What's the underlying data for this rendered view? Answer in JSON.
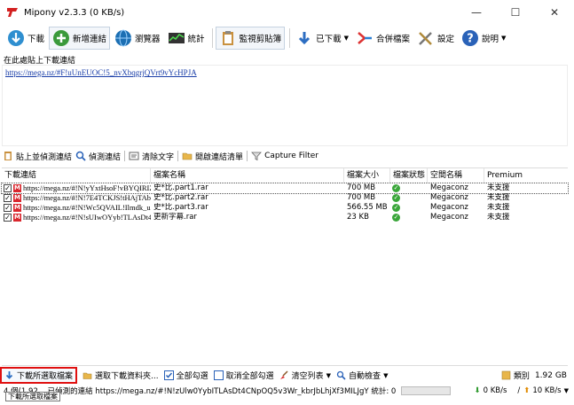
{
  "window": {
    "title": "Mipony v2.3.3 (0 KB/s)",
    "controls": {
      "minimize": "—",
      "maximize": "☐",
      "close": "✕"
    }
  },
  "toolbar": {
    "download": "下載",
    "new_link": "新增連結",
    "browser": "瀏覽器",
    "stats": "統計",
    "monitor_clipboard": "監視剪貼簿",
    "downloaded": "已下載",
    "merge_files": "合併檔案",
    "settings": "設定",
    "help": "說明"
  },
  "paste": {
    "label": "在此處貼上下載連結",
    "link": "https://mega.nz/#F!uUnEUOC!5_nvXbqgrjQVrt9vYcHPJA"
  },
  "subtoolbar": {
    "paste_detect": "貼上並偵測連結",
    "detect": "偵測連結",
    "clear_text": "清除文字",
    "open_list": "開啟連結清單",
    "capture_filter": "Capture Filter"
  },
  "table": {
    "headers": [
      "下載連結",
      "檔案名稱",
      "檔案大小",
      "檔案狀態",
      "空間名稱",
      "Premium"
    ],
    "rows": [
      {
        "link": "https://mega.nz/#!N!yYxtHsoF!vBYQIRIZ...",
        "name": "史*比.part1.rar",
        "size": "700 MB",
        "host": "Megaconz",
        "premium": "未支援"
      },
      {
        "link": "https://mega.nz/#!N!7E4TCKJS!tHAjTAbl...",
        "name": "史*比.part2.rar",
        "size": "700 MB",
        "host": "Megaconz",
        "premium": "未支援"
      },
      {
        "link": "https://mega.nz/#!N!Wc5QVAIL!Ilmdk_u7...",
        "name": "史*比.part3.rar",
        "size": "566.55 MB",
        "host": "Megaconz",
        "premium": "未支援"
      },
      {
        "link": "https://mega.nz/#!N!sUIwOYyb!TLAsDt4...",
        "name": "更新字幕.rar",
        "size": "23 KB",
        "host": "Megaconz",
        "premium": "未支援"
      }
    ]
  },
  "bottombar": {
    "download_selected": "下載所選取檔案",
    "choose_folder": "選取下載資料夾...",
    "check_all": "全部勾選",
    "uncheck_all": "取消全部勾選",
    "clear_list": "清空列表",
    "auto_check": "自動檢查",
    "category": "類別",
    "free_space": "1.92 GB"
  },
  "status": {
    "left": "4 個(1.92... 已偵測的連結 https://mega.nz/#!N!zUlw0YybITLAsDt4CNpOQ5v3Wr_kbrJbLhjXf3MILJgY 統計: 0 / 0 KB",
    "down_speed": "0 KB/s",
    "up_speed": "10 KB/s"
  },
  "tooltip": "下載所選取檔案",
  "colors": {
    "mega_red": "#d9272e",
    "highlight_red": "#e01010",
    "link_blue": "#1a3ea8",
    "ok_green": "#3aa63a"
  }
}
